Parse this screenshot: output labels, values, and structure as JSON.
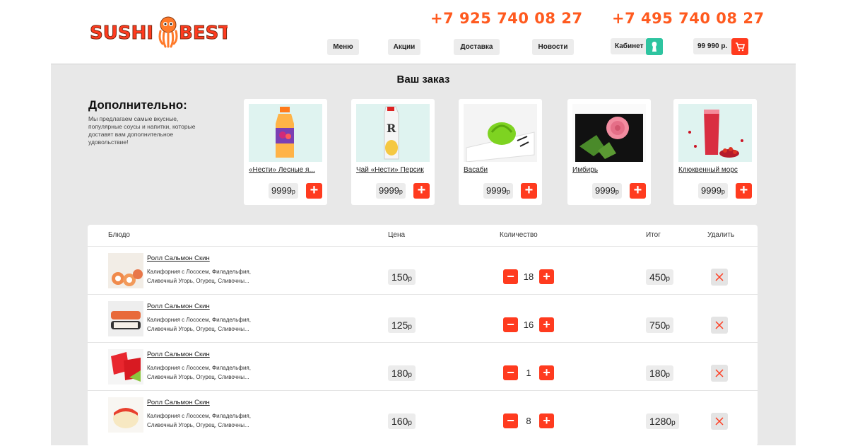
{
  "header": {
    "logo_text": "SUSHI BEST",
    "phone1": "+7 925 740 08 27",
    "phone2": "+7 495 740 08 27",
    "nav": [
      {
        "label": "Меню"
      },
      {
        "label": "Акции"
      },
      {
        "label": "Доставка"
      },
      {
        "label": "Новости"
      }
    ],
    "cabinet_label": "Кабинет",
    "cart_total": "99 990 р."
  },
  "main": {
    "title": "Ваш заказ",
    "extra_title": "Дополнительно:",
    "extra_desc": "Мы предлагаем самые вкусные, популярные соусы и напитки, которые доставят вам дополнительное удовольствие!",
    "extras": [
      {
        "name": "«Нести» Лесные я...",
        "price": "9999",
        "currency": "р",
        "add": "+"
      },
      {
        "name": "Чай «Нести» Персик",
        "price": "9999",
        "currency": "р",
        "add": "+"
      },
      {
        "name": "Васаби",
        "price": "9999",
        "currency": "р",
        "add": "+"
      },
      {
        "name": "Имбирь",
        "price": "9999",
        "currency": "р",
        "add": "+"
      },
      {
        "name": "Клюквенный морс",
        "price": "9999",
        "currency": "р",
        "add": "+"
      }
    ]
  },
  "table": {
    "headers": {
      "dish": "Блюдо",
      "price": "Цена",
      "qty": "Количество",
      "total": "Итог",
      "delete": "Удалить"
    },
    "rows": [
      {
        "name": "Ролл Сальмон Скин",
        "desc": "Калифорния с Лососем, Филадельфия, Сливочный Угорь, Огурец, Сливочны...",
        "price": "150",
        "qty": "18",
        "total": "450",
        "currency": "р"
      },
      {
        "name": "Ролл Сальмон Скин",
        "desc": "Калифорния с Лососем, Филадельфия, Сливочный Угорь, Огурец, Сливочны...",
        "price": "125",
        "qty": "16",
        "total": "750",
        "currency": "р"
      },
      {
        "name": "Ролл Сальмон Скин",
        "desc": "Калифорния с Лососем, Филадельфия, Сливочный Угорь, Огурец, Сливочны...",
        "price": "180",
        "qty": "1",
        "total": "180",
        "currency": "р"
      },
      {
        "name": "Ролл Сальмон Скин",
        "desc": "Калифорния с Лососем, Филадельфия, Сливочный Угорь, Огурец, Сливочны...",
        "price": "160",
        "qty": "8",
        "total": "1280",
        "currency": "р"
      }
    ],
    "minus": "−",
    "plus": "+"
  },
  "colors": {
    "accent": "#ff3b1f",
    "brand_orange": "#ff5a1f",
    "cabinet_green": "#2ec4a0",
    "background_gray": "#e8e8e8"
  }
}
